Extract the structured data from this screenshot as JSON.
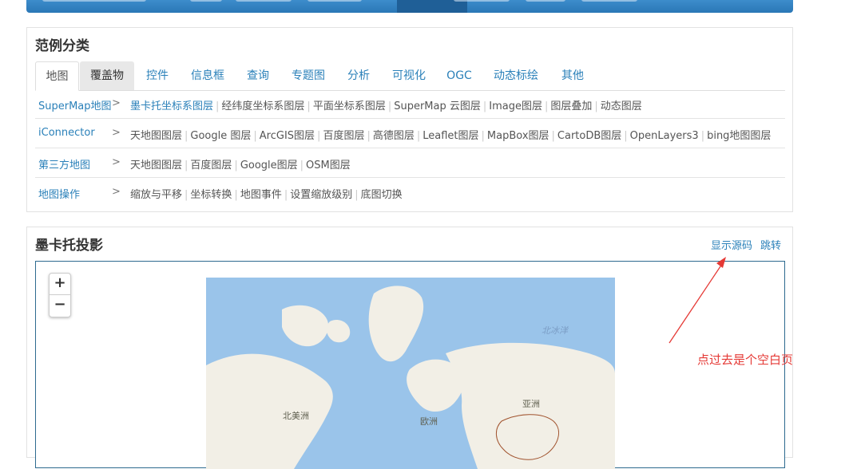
{
  "section1": {
    "title": "范例分类",
    "tabs": [
      "地图",
      "覆盖物",
      "控件",
      "信息框",
      "查询",
      "专题图",
      "分析",
      "可视化",
      "OGC",
      "动态标绘",
      "其他"
    ],
    "rows": [
      {
        "category": "SuperMap地图",
        "links": [
          "墨卡托坐标系图层",
          "经纬度坐标系图层",
          "平面坐标系图层",
          "SuperMap 云图层",
          "Image图层",
          "图层叠加",
          "动态图层"
        ]
      },
      {
        "category": "iConnector",
        "links": [
          "天地图图层",
          "Google 图层",
          "ArcGIS图层",
          "百度图层",
          "高德图层",
          "Leaflet图层",
          "MapBox图层",
          "CartoDB图层",
          "OpenLayers3",
          "bing地图图层"
        ]
      },
      {
        "category": "第三方地图",
        "links": [
          "天地图图层",
          "百度图层",
          "Google图层",
          "OSM图层"
        ]
      },
      {
        "category": "地图操作",
        "links": [
          "缩放与平移",
          "坐标转换",
          "地图事件",
          "设置缩放级别",
          "底图切换"
        ]
      }
    ],
    "arrow": ">"
  },
  "section2": {
    "title": "墨卡托投影",
    "show_source": "显示源码",
    "jump": "跳转",
    "zoom_in": "+",
    "zoom_out": "−",
    "map_labels": {
      "arctic": "北冰洋",
      "north_america": "北美洲",
      "europe": "欧洲",
      "asia": "亚洲"
    }
  },
  "annotation": {
    "text": "点过去是个空白页",
    "color": "#e53935"
  },
  "colors": {
    "accent": "#2a80b9",
    "nav": "#2a77b6",
    "ocean": "#9ac4ea",
    "land": "#f2efe6"
  }
}
